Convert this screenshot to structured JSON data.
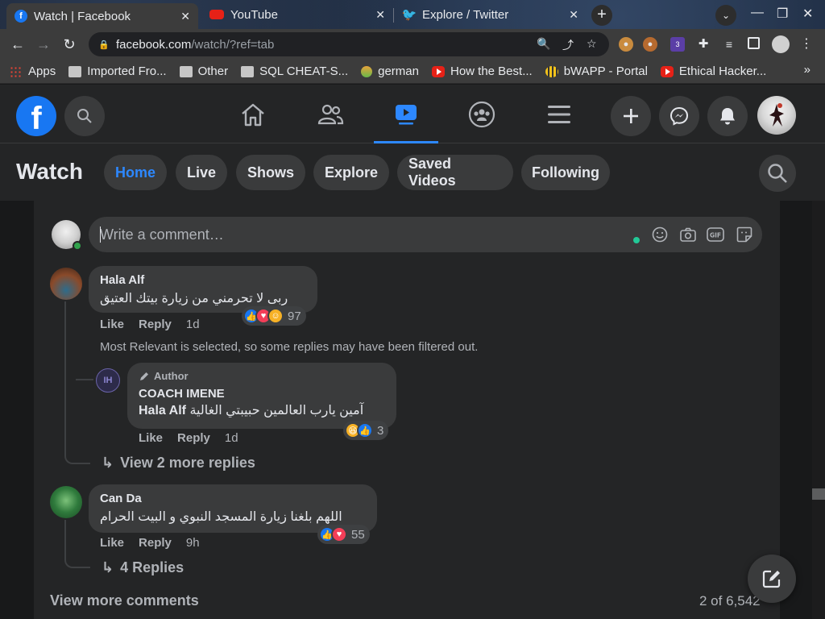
{
  "browser": {
    "tabs": [
      {
        "label": "Watch | Facebook",
        "favicon": "facebook-icon",
        "active": true
      },
      {
        "label": "YouTube",
        "favicon": "youtube-icon",
        "active": false
      },
      {
        "label": "Explore / Twitter",
        "favicon": "twitter-icon",
        "active": false
      }
    ],
    "url_host": "facebook.com",
    "url_path": "/watch/?ref=tab",
    "extension_badge": "3",
    "bookmarks": [
      {
        "label": "Apps",
        "icon": "apps-grid-icon"
      },
      {
        "label": "Imported Fro...",
        "icon": "folder-icon"
      },
      {
        "label": "Other",
        "icon": "folder-icon"
      },
      {
        "label": "SQL CHEAT-S...",
        "icon": "folder-icon"
      },
      {
        "label": "german",
        "icon": "german-icon"
      },
      {
        "label": "How the Best...",
        "icon": "youtube-icon"
      },
      {
        "label": "bWAPP - Portal",
        "icon": "bee-icon"
      },
      {
        "label": "Ethical Hacker...",
        "icon": "youtube-icon"
      }
    ],
    "bookmarks_overflow": "»"
  },
  "fb": {
    "logo": "f",
    "section_title": "Watch",
    "watch_tabs": [
      "Home",
      "Live",
      "Shows",
      "Explore",
      "Saved Videos",
      "Following"
    ],
    "active_watch_tab": "Home",
    "accent": "#2d88ff",
    "brand": "#1877f2"
  },
  "composer": {
    "placeholder": "Write a comment…"
  },
  "comments": [
    {
      "author": "Hala Alf",
      "text": "ربى لا تحرمني من زيارة بيتك العتيق",
      "like": "Like",
      "reply": "Reply",
      "time": "1d",
      "reactions": [
        "like",
        "love",
        "care"
      ],
      "reaction_count": "97"
    },
    {
      "author": "Can Da",
      "text": "اللهم بلغنا زيارة المسجد النبوي و البيت الحرام",
      "like": "Like",
      "reply": "Reply",
      "time": "9h",
      "reactions": [
        "like",
        "love"
      ],
      "reaction_count": "55"
    }
  ],
  "filter_note": "Most Relevant is selected, so some replies may have been filtered out.",
  "reply": {
    "badge": "Author",
    "author": "COACH IMENE",
    "mention": "Hala Alf",
    "text": "آمين يارب العالمين حبيبتي الغالية",
    "like": "Like",
    "reply": "Reply",
    "time": "1d",
    "reactions": [
      "haha",
      "like"
    ],
    "reaction_count": "3",
    "avatar_initials": "IH"
  },
  "view_more_replies": "View 2 more replies",
  "replies_count": "4 Replies",
  "view_more_comments": "View more comments",
  "comment_position": "2 of 6,542"
}
